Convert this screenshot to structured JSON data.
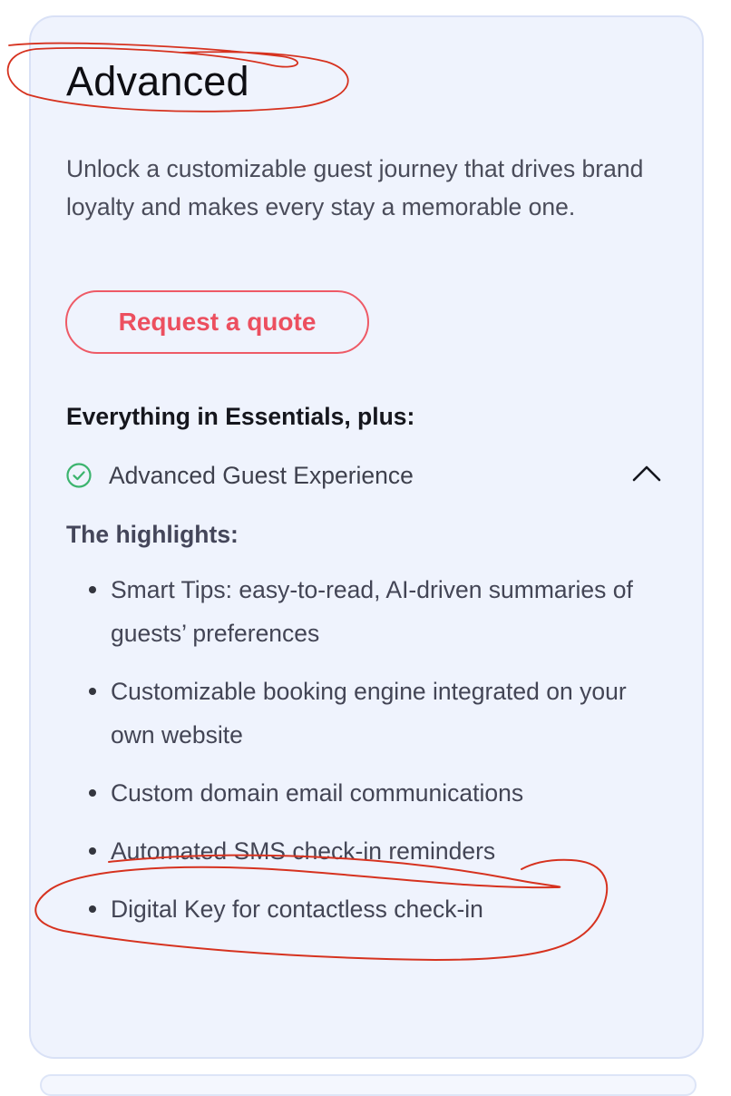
{
  "plan": {
    "title": "Advanced",
    "description": "Unlock a customizable guest journey that drives brand loyalty and makes every stay a memorable one.",
    "cta_label": "Request a quote",
    "includes_heading": "Everything in Essentials, plus:",
    "feature": {
      "label": "Advanced Guest Experience",
      "icon": "check-circle-icon",
      "expanded": true
    },
    "highlights_heading": "The highlights:",
    "highlights": [
      "Smart Tips: easy-to-read, AI-driven summaries of guests’ preferences",
      "Customizable booking engine integrated on your own website",
      "Custom domain email communications",
      "Automated SMS check-in reminders",
      "Digital Key for contactless check-in"
    ]
  },
  "colors": {
    "card_background": "#eff3fd",
    "card_border": "#d9e1f6",
    "accent": "#ec4f5f",
    "check_green": "#3cb46e",
    "annotation_red": "#d6321f"
  }
}
